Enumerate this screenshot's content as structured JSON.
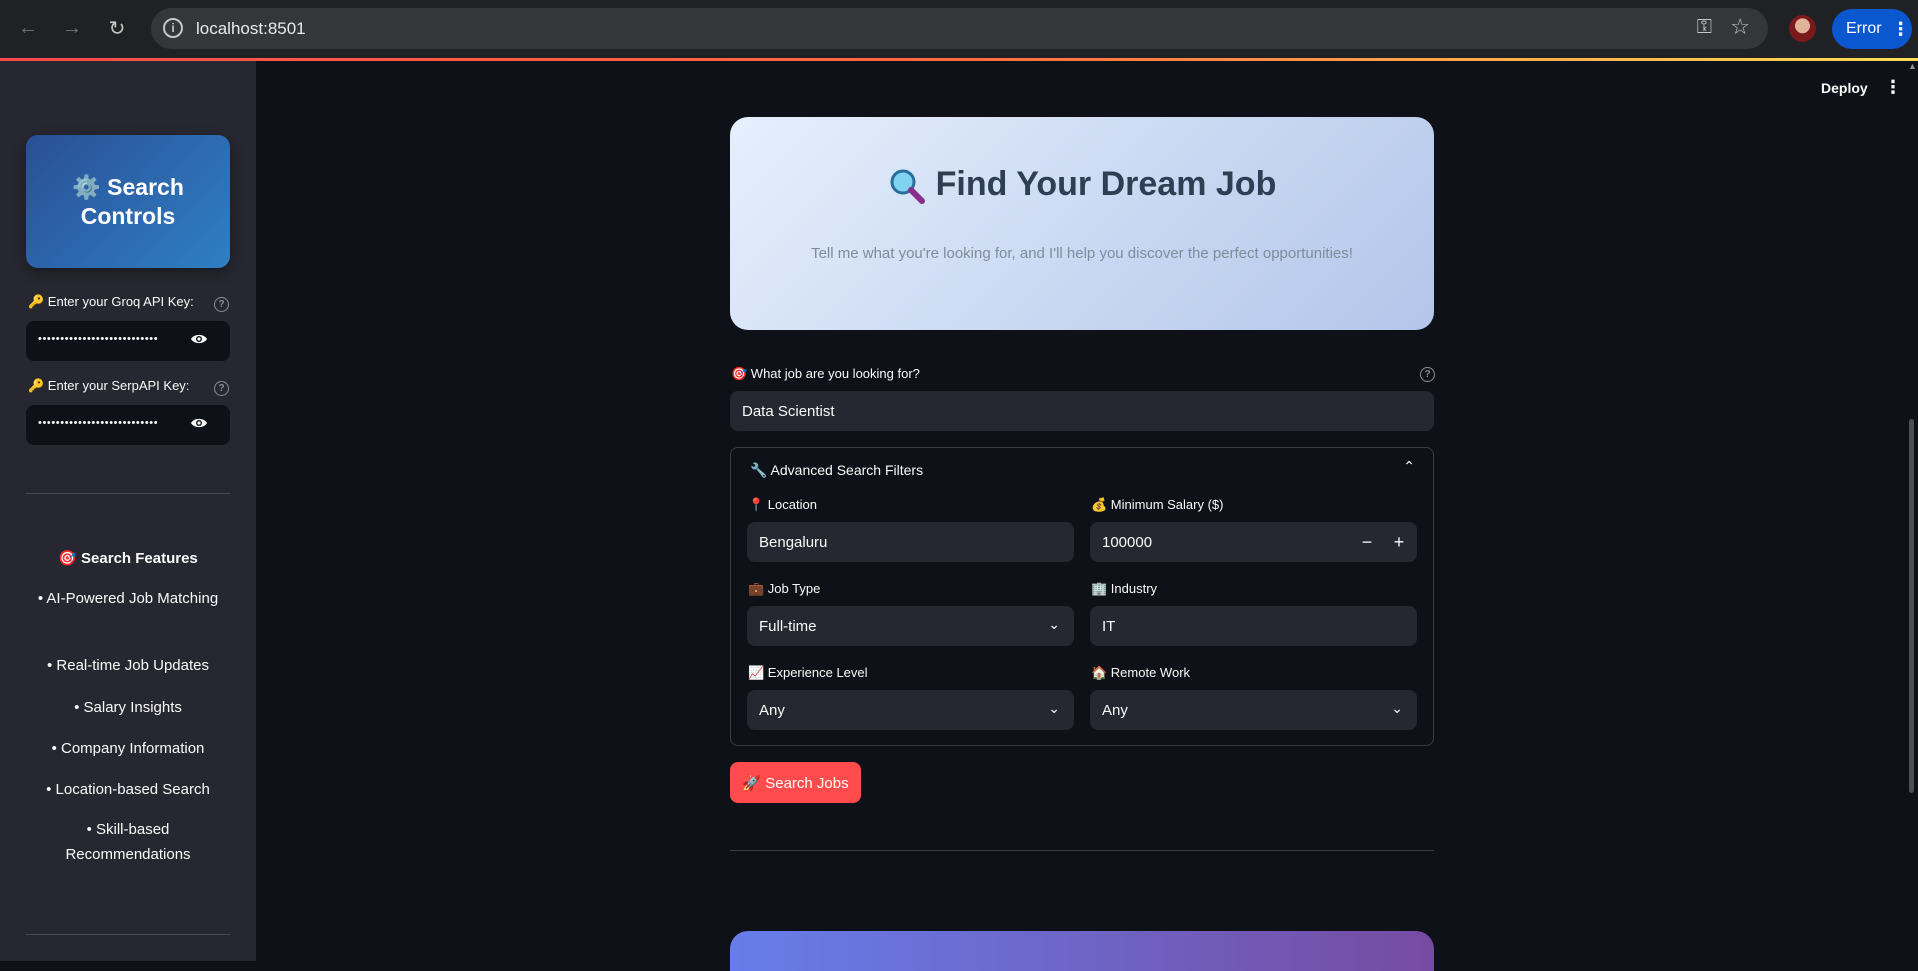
{
  "browser": {
    "url": "localhost:8501",
    "profile_status": "Error"
  },
  "sidebar": {
    "title": "⚙️ Search Controls",
    "groq_label": "🔑 Enter your Groq API Key:",
    "groq_value": "•••••••••••••••••••••••••••",
    "serp_label": "🔑 Enter your SerpAPI Key:",
    "serp_value": "•••••••••••••••••••••••••••",
    "features_title": "🎯 Search Features",
    "features": [
      "• AI-Powered Job Matching",
      "• Real-time Job Updates",
      "• Salary Insights",
      "• Company Information",
      "• Location-based Search",
      "• Skill-based Recommendations"
    ]
  },
  "header": {
    "deploy_label": "Deploy"
  },
  "hero": {
    "title": "Find Your Dream Job",
    "subtitle": "Tell me what you're looking for, and I'll help you discover the perfect opportunities!"
  },
  "job_query": {
    "label": "🎯 What job are you looking for?",
    "value": "Data Scientist"
  },
  "filters": {
    "title": "🔧 Advanced Search Filters",
    "location_label": "📍 Location",
    "location_value": "Bengaluru",
    "salary_label": "💰 Minimum Salary ($)",
    "salary_value": "100000",
    "job_type_label": "💼 Job Type",
    "job_type_value": "Full-time",
    "industry_label": "🏢 Industry",
    "industry_value": "IT",
    "experience_label": "📈 Experience Level",
    "experience_value": "Any",
    "remote_label": "🏠 Remote Work",
    "remote_value": "Any"
  },
  "search_button": "🚀 Search Jobs"
}
